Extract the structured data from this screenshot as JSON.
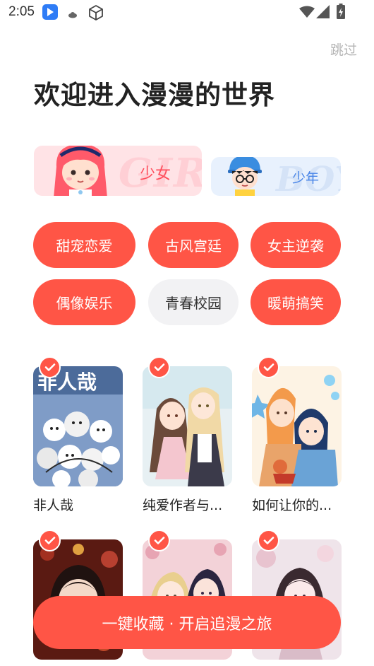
{
  "status_bar": {
    "time": "2:05"
  },
  "header": {
    "skip_label": "跳过",
    "title": "欢迎进入漫漫的世界"
  },
  "gender": {
    "girl": {
      "label": "少女",
      "bg_text": "GIRL"
    },
    "boy": {
      "label": "少年",
      "bg_text": "BOY"
    }
  },
  "tags": [
    {
      "label": "甜宠恋爱",
      "selected": true
    },
    {
      "label": "古风宫廷",
      "selected": true
    },
    {
      "label": "女主逆袭",
      "selected": true
    },
    {
      "label": "偶像娱乐",
      "selected": true
    },
    {
      "label": "青春校园",
      "selected": false
    },
    {
      "label": "暖萌搞笑",
      "selected": true
    }
  ],
  "comics": [
    {
      "title": "非人哉",
      "cover_text": "非人哉",
      "selected": true
    },
    {
      "title": "纯爱作者与...",
      "selected": true
    },
    {
      "title": "如何让你的...",
      "selected": true
    },
    {
      "title": "",
      "selected": true
    },
    {
      "title": "",
      "selected": true
    },
    {
      "title": "",
      "selected": true
    }
  ],
  "cta": {
    "label": "一键收藏 · 开启追漫之旅"
  },
  "colors": {
    "accent": "#ff5546",
    "tag_off": "#f2f2f4",
    "girl_card": "#ffe3e6",
    "boy_card": "#e8f1fd"
  }
}
